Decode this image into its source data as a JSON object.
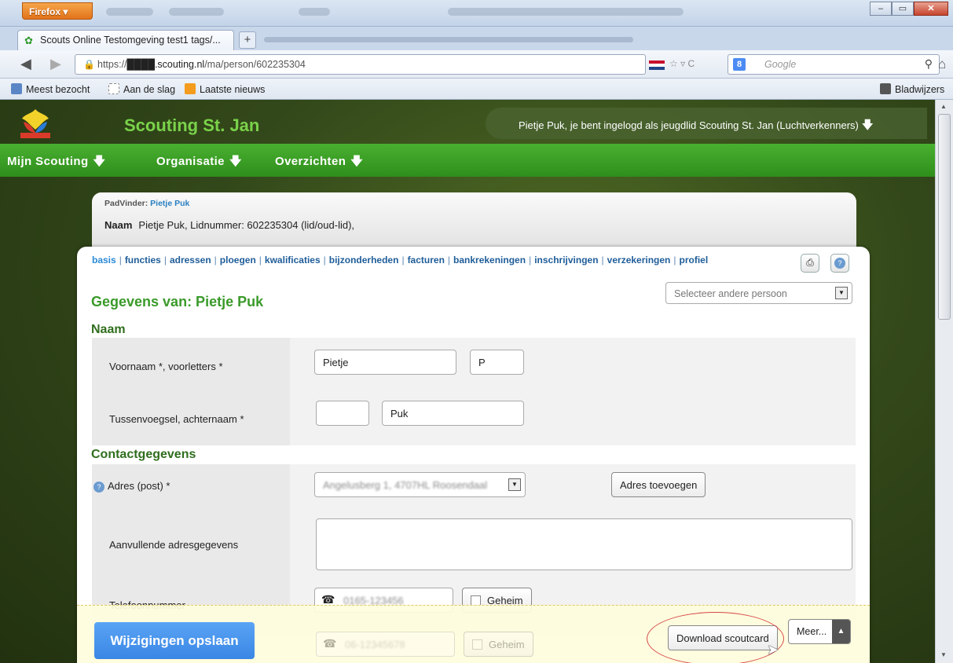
{
  "browser": {
    "menu_button": "Firefox ▾",
    "tab_title": "Scouts Online Testomgeving test1 tags/...",
    "new_tab": "+",
    "url_prefix": "https://",
    "url_domain": "████.scouting.nl",
    "url_path": "/ma/person/602235304",
    "search_placeholder": "Google",
    "bookmarks": [
      {
        "label": "Meest bezocht"
      },
      {
        "label": "Aan de slag"
      },
      {
        "label": "Laatste nieuws"
      }
    ],
    "bookmarks_menu": "Bladwijzers"
  },
  "site": {
    "title": "Scouting St. Jan",
    "login_text": "Pietje Puk, je bent ingelogd als jeugdlid Scouting St. Jan (Luchtverkenners)",
    "menu": [
      {
        "label": "Mijn Scouting"
      },
      {
        "label": "Organisatie"
      },
      {
        "label": "Overzichten"
      }
    ]
  },
  "padvinder": {
    "label": "PadVinder:",
    "person": "Pietje Puk",
    "naam_label": "Naam",
    "naam_value": "Pietje Puk, Lidnummer: 602235304 (lid/oud-lid),"
  },
  "tabs": [
    {
      "label": "basis",
      "active": true
    },
    {
      "label": "functies"
    },
    {
      "label": "adressen"
    },
    {
      "label": "ploegen"
    },
    {
      "label": "kwalificaties"
    },
    {
      "label": "bijzonderheden"
    },
    {
      "label": "facturen"
    },
    {
      "label": "bankrekeningen"
    },
    {
      "label": "inschrijvingen"
    },
    {
      "label": "verzekeringen"
    },
    {
      "label": "profiel"
    }
  ],
  "select_person": "Selecteer andere persoon",
  "page_title": "Gegevens van: Pietje Puk",
  "sections": {
    "naam": "Naam",
    "contact": "Contactgegevens"
  },
  "fields": {
    "voornaam_label": "Voornaam *, voorletters *",
    "voornaam_value": "Pietje",
    "voorletters_value": "P",
    "achternaam_label": "Tussenvoegsel, achternaam *",
    "tussenvoegsel_value": "",
    "achternaam_value": "Puk",
    "adres_label": "Adres (post) *",
    "adres_value": "Angelusberg 1, 4707HL Roosendaal",
    "adres_toevoegen": "Adres toevoegen",
    "aanvullend_label": "Aanvullende adresgegevens",
    "telefoon_label": "Telefoonnummer",
    "telefoon_value": "0165-123456",
    "telefoon2_value": "06-12345678",
    "geheim_label": "Geheim"
  },
  "footer": {
    "save": "Wijzigingen opslaan",
    "download": "Download scoutcard",
    "meer": "Meer..."
  }
}
